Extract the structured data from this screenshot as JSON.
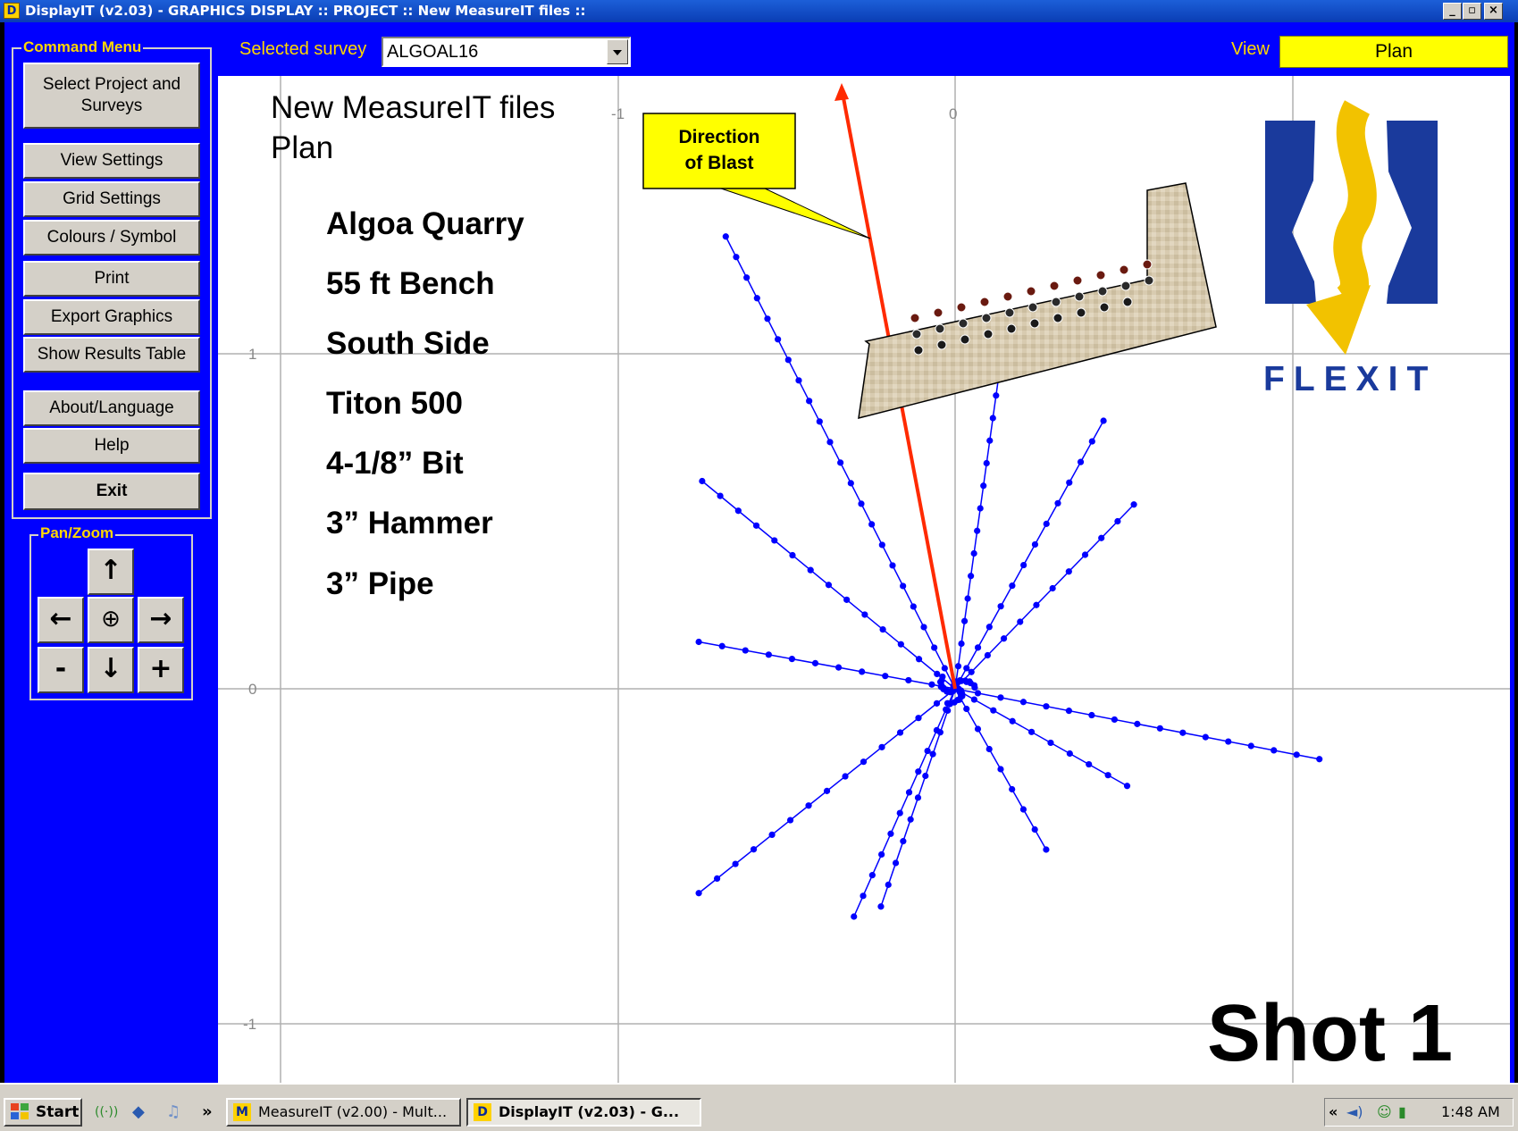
{
  "window": {
    "app_icon": "D",
    "title": "DisplayIT (v2.03) - GRAPHICS DISPLAY :: PROJECT :: New MeasureIT files ::",
    "controls": [
      "minimize",
      "maximize",
      "close"
    ]
  },
  "topbar": {
    "survey_label": "Selected survey",
    "survey_value": "ALGOAL16",
    "view_label": "View",
    "view_value": "Plan"
  },
  "command_menu": {
    "title": "Command Menu",
    "buttons": [
      {
        "label": "Select Project and Surveys"
      },
      {
        "label": "View Settings"
      },
      {
        "label": "Grid Settings"
      },
      {
        "label": "Colours / Symbol"
      },
      {
        "label": "Print"
      },
      {
        "label": "Export Graphics"
      },
      {
        "label": "Show Results Table"
      },
      {
        "label": "About/Language"
      },
      {
        "label": "Help"
      },
      {
        "label": "Exit"
      }
    ]
  },
  "pan_zoom": {
    "title": "Pan/Zoom",
    "up": "↑",
    "left": "←",
    "center": "⊕",
    "right": "→",
    "zoom_out": "-",
    "down": "↓",
    "zoom_in": "+"
  },
  "plot": {
    "title_line1": "New MeasureIT files",
    "title_line2": "Plan",
    "info_lines": [
      "Algoa Quarry",
      "55 ft Bench",
      "South Side",
      "Titon 500",
      "4-1/8” Bit",
      "3” Hammer",
      "3” Pipe"
    ],
    "callout": [
      "Direction",
      "of Blast"
    ],
    "logo_text": "FLEXIT",
    "shot_label": "Shot 1",
    "x_ticks": [
      "-1",
      "0"
    ],
    "y_ticks": [
      "1",
      "0",
      "-1"
    ],
    "line_color": "#0000ff",
    "arrow_color": "#ff2a00"
  },
  "chart_data": {
    "type": "line",
    "title": "",
    "x_ticks": [
      -1,
      0,
      1
    ],
    "y_ticks": [
      1,
      0,
      -1
    ],
    "series": [
      {
        "values": [
          [
            0,
            0
          ],
          [
            -0.68,
            1.35
          ]
        ]
      },
      {
        "values": [
          [
            0,
            0
          ],
          [
            -0.75,
            0.62
          ]
        ]
      },
      {
        "values": [
          [
            0,
            0
          ],
          [
            -0.76,
            0.14
          ]
        ]
      },
      {
        "values": [
          [
            0,
            0
          ],
          [
            -0.76,
            -0.61
          ]
        ]
      },
      {
        "values": [
          [
            0,
            0
          ],
          [
            -0.3,
            -0.68
          ]
        ]
      },
      {
        "values": [
          [
            0,
            0
          ],
          [
            -0.22,
            -0.65
          ]
        ]
      },
      {
        "values": [
          [
            0,
            0
          ],
          [
            0.27,
            -0.48
          ]
        ]
      },
      {
        "values": [
          [
            0,
            0
          ],
          [
            0.51,
            -0.29
          ]
        ]
      },
      {
        "values": [
          [
            0,
            0
          ],
          [
            1.08,
            -0.21
          ]
        ]
      },
      {
        "values": [
          [
            0,
            0
          ],
          [
            0.53,
            0.55
          ]
        ]
      },
      {
        "values": [
          [
            0,
            0
          ],
          [
            0.44,
            0.8
          ]
        ]
      },
      {
        "values": [
          [
            0,
            0
          ],
          [
            0.14,
            1.01
          ]
        ]
      }
    ]
  },
  "taskbar": {
    "start_label": "Start",
    "tasks": [
      {
        "icon": "M",
        "label": "MeasureIT (v2.00) - Mult..."
      },
      {
        "icon": "D",
        "label": "DisplayIT (v2.03) - G..."
      }
    ],
    "clock": "1:48 AM",
    "overflow": "»",
    "tray_chevron": "«"
  }
}
